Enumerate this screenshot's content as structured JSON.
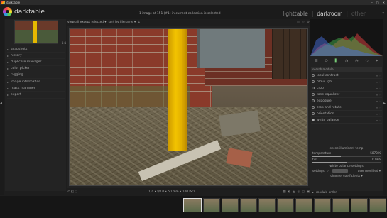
{
  "window": {
    "title": "darktable",
    "controls": [
      "–",
      "□",
      "✕"
    ]
  },
  "header": {
    "brand": "darktable",
    "collection_status": "1 image of 151 (#1) in current collection is selected",
    "views": {
      "lighttable": "lighttable",
      "darkroom": "darkroom",
      "other": "other",
      "sep": "|"
    },
    "views_menu_arrow": "▾"
  },
  "left_panel": {
    "navigation_label": "1:1",
    "modules": [
      {
        "label": "snapshots"
      },
      {
        "label": "history"
      },
      {
        "label": "duplicate manager"
      },
      {
        "label": "color picker"
      },
      {
        "label": "tagging"
      },
      {
        "label": "image information"
      },
      {
        "label": "mask manager"
      },
      {
        "label": "export"
      }
    ],
    "arrow": "▸"
  },
  "center_toolbar": {
    "filter": "view  all except rejected ▾",
    "sort": "sort by  filename ▾",
    "sort_dir": "↕"
  },
  "center_bottom": {
    "zoom_text": "1/4 • f/8.0 • 50 mm • 100 ISO"
  },
  "right_panel": {
    "search_placeholder": "search module",
    "modules": [
      {
        "label": "local contrast",
        "on": false
      },
      {
        "label": "filmic rgb",
        "on": false
      },
      {
        "label": "crop",
        "on": false
      },
      {
        "label": "tone equalizer",
        "on": false
      },
      {
        "label": "exposure",
        "on": false
      },
      {
        "label": "crop and rotate",
        "on": false
      },
      {
        "label": "orientation",
        "on": false
      },
      {
        "label": "white balance",
        "on": true
      }
    ],
    "white_balance": {
      "scene_illuminant": "scene illuminant temp",
      "temperature_label": "temperature",
      "temperature_value": "5870 K",
      "temperature_fraction": 0.42,
      "tint_label": "tint",
      "tint_value": "0.986",
      "tint_fraction": 0.5,
      "wb_settings": "white balance settings",
      "settings_label": "settings",
      "settings_value": "user modified ▾",
      "channel_coefficients": "channel coefficients ▾"
    },
    "module_order": "module order"
  },
  "colors": {
    "accent": "#7c7",
    "post": "#f2c300"
  }
}
